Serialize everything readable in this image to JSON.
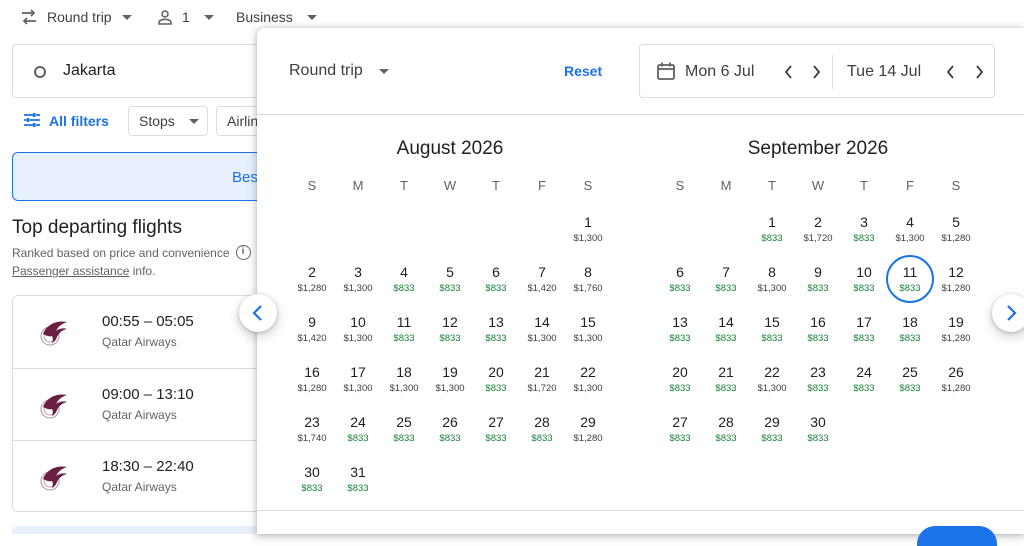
{
  "topbar": {
    "trip_type": "Round trip",
    "passengers": "1",
    "cabin": "Business"
  },
  "search": {
    "origin": "Jakarta"
  },
  "filters": {
    "all_filters": "All filters",
    "stops": "Stops",
    "airlines_partial": "Airlin"
  },
  "tab": {
    "best_partial": "Bes"
  },
  "results": {
    "title": "Top departing flights",
    "ranked_note": "Ranked based on price and convenience",
    "passenger_link": "Passenger assistance",
    "passenger_suffix": " info.",
    "flights": [
      {
        "time": "00:55 – 05:05",
        "airline": "Qatar Airways"
      },
      {
        "time": "09:00 – 13:10",
        "airline": "Qatar Airways"
      },
      {
        "time": "18:30 – 22:40",
        "airline": "Qatar Airways"
      }
    ]
  },
  "picker": {
    "trip_type": "Round trip",
    "reset": "Reset",
    "depart": "Mon 6 Jul",
    "return": "Tue 14 Jul",
    "weekdays": [
      "S",
      "M",
      "T",
      "W",
      "T",
      "F",
      "S"
    ],
    "months": [
      {
        "title": "August 2026",
        "first_weekday": 6,
        "days": [
          {
            "d": "1",
            "p": "$1,300"
          },
          {
            "d": "2",
            "p": "$1,280"
          },
          {
            "d": "3",
            "p": "$1,300"
          },
          {
            "d": "4",
            "p": "$833",
            "low": true
          },
          {
            "d": "5",
            "p": "$833",
            "low": true
          },
          {
            "d": "6",
            "p": "$833",
            "low": true
          },
          {
            "d": "7",
            "p": "$1,420"
          },
          {
            "d": "8",
            "p": "$1,760"
          },
          {
            "d": "9",
            "p": "$1,420"
          },
          {
            "d": "10",
            "p": "$1,300"
          },
          {
            "d": "11",
            "p": "$833",
            "low": true
          },
          {
            "d": "12",
            "p": "$833",
            "low": true
          },
          {
            "d": "13",
            "p": "$833",
            "low": true
          },
          {
            "d": "14",
            "p": "$1,300"
          },
          {
            "d": "15",
            "p": "$1,300"
          },
          {
            "d": "16",
            "p": "$1,280"
          },
          {
            "d": "17",
            "p": "$1,300"
          },
          {
            "d": "18",
            "p": "$1,300"
          },
          {
            "d": "19",
            "p": "$1,300"
          },
          {
            "d": "20",
            "p": "$833",
            "low": true
          },
          {
            "d": "21",
            "p": "$1,720"
          },
          {
            "d": "22",
            "p": "$1,300"
          },
          {
            "d": "23",
            "p": "$1,740"
          },
          {
            "d": "24",
            "p": "$833",
            "low": true
          },
          {
            "d": "25",
            "p": "$833",
            "low": true
          },
          {
            "d": "26",
            "p": "$833",
            "low": true
          },
          {
            "d": "27",
            "p": "$833",
            "low": true
          },
          {
            "d": "28",
            "p": "$833",
            "low": true
          },
          {
            "d": "29",
            "p": "$1,280"
          },
          {
            "d": "30",
            "p": "$833",
            "low": true
          },
          {
            "d": "31",
            "p": "$833",
            "low": true
          }
        ]
      },
      {
        "title": "September 2026",
        "first_weekday": 2,
        "days": [
          {
            "d": "1",
            "p": "$833",
            "low": true
          },
          {
            "d": "2",
            "p": "$1,720"
          },
          {
            "d": "3",
            "p": "$833",
            "low": true
          },
          {
            "d": "4",
            "p": "$1,300"
          },
          {
            "d": "5",
            "p": "$1,280"
          },
          {
            "d": "6",
            "p": "$833",
            "low": true
          },
          {
            "d": "7",
            "p": "$833",
            "low": true
          },
          {
            "d": "8",
            "p": "$1,300"
          },
          {
            "d": "9",
            "p": "$833",
            "low": true
          },
          {
            "d": "10",
            "p": "$833",
            "low": true
          },
          {
            "d": "11",
            "p": "$833",
            "low": true,
            "selected": true
          },
          {
            "d": "12",
            "p": "$1,280"
          },
          {
            "d": "13",
            "p": "$833",
            "low": true
          },
          {
            "d": "14",
            "p": "$833",
            "low": true
          },
          {
            "d": "15",
            "p": "$833",
            "low": true
          },
          {
            "d": "16",
            "p": "$833",
            "low": true
          },
          {
            "d": "17",
            "p": "$833",
            "low": true
          },
          {
            "d": "18",
            "p": "$833",
            "low": true
          },
          {
            "d": "19",
            "p": "$1,280"
          },
          {
            "d": "20",
            "p": "$833",
            "low": true
          },
          {
            "d": "21",
            "p": "$833",
            "low": true
          },
          {
            "d": "22",
            "p": "$1,300"
          },
          {
            "d": "23",
            "p": "$833",
            "low": true
          },
          {
            "d": "24",
            "p": "$833",
            "low": true
          },
          {
            "d": "25",
            "p": "$833",
            "low": true
          },
          {
            "d": "26",
            "p": "$1,280"
          },
          {
            "d": "27",
            "p": "$833",
            "low": true
          },
          {
            "d": "28",
            "p": "$833",
            "low": true
          },
          {
            "d": "29",
            "p": "$833",
            "low": true
          },
          {
            "d": "30",
            "p": "$833",
            "low": true
          }
        ]
      }
    ]
  },
  "colors": {
    "accent": "#1a73e8",
    "low_price": "#188038",
    "border": "#dadce0",
    "airline_brand": "#6b1e3f"
  },
  "icons": {
    "trip": "swap-arrows-icon",
    "passenger": "person-icon",
    "origin": "circle-origin-icon",
    "filters": "tune-icon",
    "calendar": "calendar-icon",
    "airline": "qatar-airways-logo"
  }
}
